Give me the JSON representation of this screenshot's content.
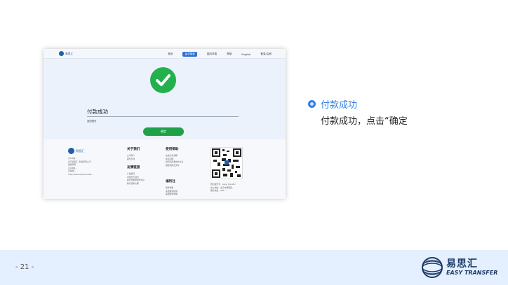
{
  "screenshot": {
    "nav": {
      "logo": "易思汇",
      "items": [
        "首页",
        "留学缴费",
        "国内学费",
        "帮助",
        "English",
        "登录/注册"
      ],
      "active_index": 1
    },
    "payment": {
      "title": "付款成功",
      "subtitle": "返回首页",
      "button": "确定"
    },
    "footer": {
      "logo": "易思汇",
      "info_lines": [
        "沪ICP备...",
        "北京易思汇..科技有限公司",
        "版权所有",
        "京ICP备...",
        "互联网...",
        "http://www.easytransfer..."
      ],
      "col_about": {
        "title": "关于我们",
        "items": [
          "公司简介",
          "服务条款"
        ]
      },
      "col_links": {
        "title": "友情链接",
        "items": [
          "广发银行",
          "中国光大银行",
          "教育部留学服务中心",
          "教育部学信网"
        ]
      },
      "col_help": {
        "title": "使用帮助",
        "items": [
          "在线付款流程",
          "常见问题",
          "如何获得收款方信息",
          "缴费指南及文件"
        ]
      },
      "col_benefit": {
        "title": "福利社",
        "items": [
          "留学攻略",
          "英国留学指南",
          "美国留学攻略"
        ]
      },
      "contact_lines": [
        "微信服务号：easy_transfer",
        "办公地址：北京市朝阳区...",
        "服务热线：400-..."
      ]
    }
  },
  "annotation": {
    "title": "付款成功",
    "description": "付款成功，点击“确定"
  },
  "footer_band": {
    "page_number": "- 21 -",
    "brand_cn": "易思汇",
    "brand_en": "EASY TRANSFER"
  },
  "colors": {
    "accent": "#2f7fe0",
    "success": "#23b04d",
    "band": "#e4efff",
    "brand": "#1d3a66"
  }
}
